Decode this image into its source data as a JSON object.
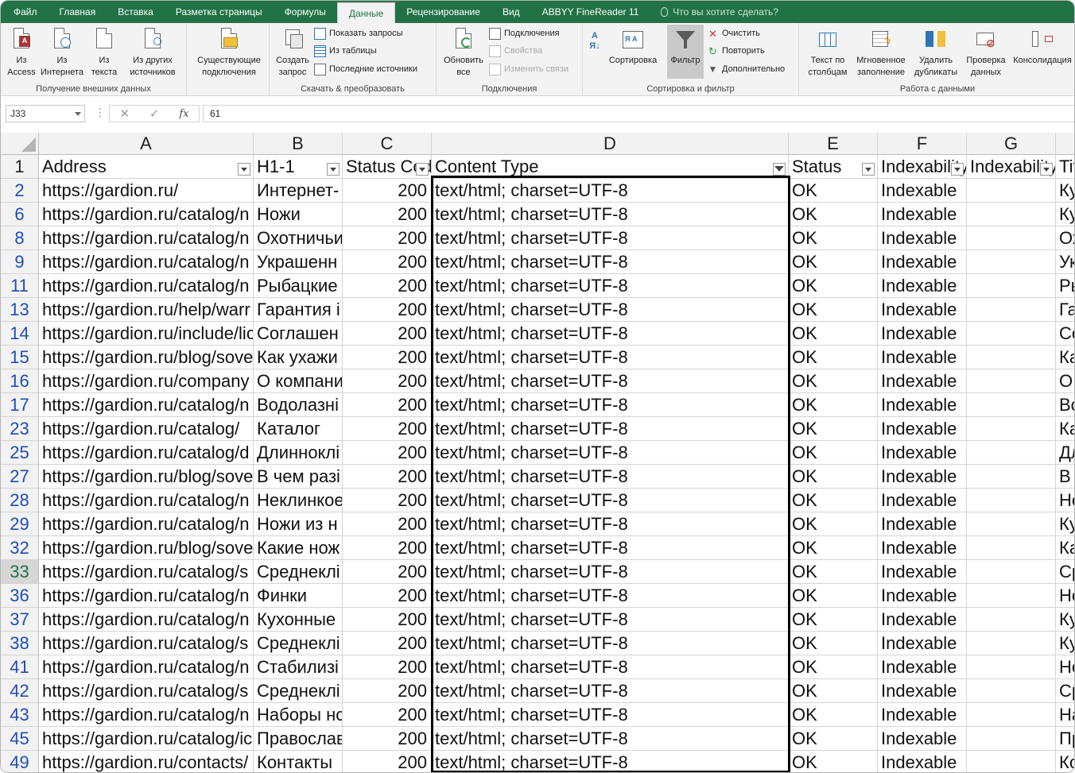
{
  "tabs": [
    "Файл",
    "Главная",
    "Вставка",
    "Разметка страницы",
    "Формулы",
    "Данные",
    "Рецензирование",
    "Вид",
    "ABBYY FineReader 11"
  ],
  "active_tab": "Данные",
  "tell_me": "Что вы хотите сделать?",
  "ribbon": {
    "external": {
      "label": "Получение внешних данных",
      "access": "Из Access",
      "access_l1": "Из",
      "access_l2": "Access",
      "web_l1": "Из",
      "web_l2": "Интернета",
      "text_l1": "Из",
      "text_l2": "текста",
      "other_l1": "Из других",
      "other_l2": "источников",
      "existing_l1": "Существующие",
      "existing_l2": "подключения"
    },
    "transform": {
      "label": "Скачать & преобразовать",
      "new_query_l1": "Создать",
      "new_query_l2": "запрос",
      "show_queries": "Показать запросы",
      "from_table": "Из таблицы",
      "recent_sources": "Последние источники"
    },
    "connections": {
      "label": "Подключения",
      "refresh_l1": "Обновить",
      "refresh_l2": "все",
      "connections": "Подключения",
      "properties": "Свойства",
      "edit_links": "Изменить связи"
    },
    "sortfilter": {
      "label": "Сортировка и фильтр",
      "sort": "Сортировка",
      "filter": "Фильтр",
      "clear": "Очистить",
      "reapply": "Повторить",
      "advanced": "Дополнительно"
    },
    "datatools": {
      "label": "Работа с данными",
      "text_cols_l1": "Текст по",
      "text_cols_l2": "столбцам",
      "flash_l1": "Мгновенное",
      "flash_l2": "заполнение",
      "remove_dup_l1": "Удалить",
      "remove_dup_l2": "дубликаты",
      "validate_l1": "Проверка",
      "validate_l2": "данных",
      "consolidate": "Консолидация"
    }
  },
  "formula_bar": {
    "name_box": "J33",
    "fx": "fx",
    "value": "61"
  },
  "columns": [
    "A",
    "B",
    "C",
    "D",
    "E",
    "F",
    "G",
    ""
  ],
  "header_row": {
    "row": "1",
    "cells": [
      "Address",
      "H1-1",
      "Status Code",
      "Content Type",
      "Status",
      "Indexability",
      "Indexability Status",
      "Title"
    ]
  },
  "selected_row": "33",
  "rows": [
    {
      "n": "2",
      "a": "https://gardion.ru/",
      "b": "Интернет-",
      "c": "200",
      "d": "text/html; charset=UTF-8",
      "e": "OK",
      "f": "Indexable",
      "h": "Ку"
    },
    {
      "n": "6",
      "a": "https://gardion.ru/catalog/n",
      "b": "Ножи",
      "c": "200",
      "d": "text/html; charset=UTF-8",
      "e": "OK",
      "f": "Indexable",
      "h": "Ку"
    },
    {
      "n": "8",
      "a": "https://gardion.ru/catalog/n",
      "b": "Охотничьи",
      "c": "200",
      "d": "text/html; charset=UTF-8",
      "e": "OK",
      "f": "Indexable",
      "h": "Ох"
    },
    {
      "n": "9",
      "a": "https://gardion.ru/catalog/n",
      "b": "Украшенн",
      "c": "200",
      "d": "text/html; charset=UTF-8",
      "e": "OK",
      "f": "Indexable",
      "h": "Ук"
    },
    {
      "n": "11",
      "a": "https://gardion.ru/catalog/n",
      "b": "Рыбацкие",
      "c": "200",
      "d": "text/html; charset=UTF-8",
      "e": "OK",
      "f": "Indexable",
      "h": "Ры"
    },
    {
      "n": "13",
      "a": "https://gardion.ru/help/warr",
      "b": "Гарантия і",
      "c": "200",
      "d": "text/html; charset=UTF-8",
      "e": "OK",
      "f": "Indexable",
      "h": "Га"
    },
    {
      "n": "14",
      "a": "https://gardion.ru/include/lic",
      "b": "Соглашен",
      "c": "200",
      "d": "text/html; charset=UTF-8",
      "e": "OK",
      "f": "Indexable",
      "h": "Со"
    },
    {
      "n": "15",
      "a": "https://gardion.ru/blog/sove",
      "b": "Как ухажи",
      "c": "200",
      "d": "text/html; charset=UTF-8",
      "e": "OK",
      "f": "Indexable",
      "h": "Ка"
    },
    {
      "n": "16",
      "a": "https://gardion.ru/company",
      "b": "О компани",
      "c": "200",
      "d": "text/html; charset=UTF-8",
      "e": "OK",
      "f": "Indexable",
      "h": "О"
    },
    {
      "n": "17",
      "a": "https://gardion.ru/catalog/n",
      "b": "Водолазні",
      "c": "200",
      "d": "text/html; charset=UTF-8",
      "e": "OK",
      "f": "Indexable",
      "h": "Во"
    },
    {
      "n": "23",
      "a": "https://gardion.ru/catalog/",
      "b": "Каталог",
      "c": "200",
      "d": "text/html; charset=UTF-8",
      "e": "OK",
      "f": "Indexable",
      "h": "Ка"
    },
    {
      "n": "25",
      "a": "https://gardion.ru/catalog/d",
      "b": "Длинноклі",
      "c": "200",
      "d": "text/html; charset=UTF-8",
      "e": "OK",
      "f": "Indexable",
      "h": "Дл"
    },
    {
      "n": "27",
      "a": "https://gardion.ru/blog/sove",
      "b": "В чем разі",
      "c": "200",
      "d": "text/html; charset=UTF-8",
      "e": "OK",
      "f": "Indexable",
      "h": "В"
    },
    {
      "n": "28",
      "a": "https://gardion.ru/catalog/n",
      "b": "Неклинкое",
      "c": "200",
      "d": "text/html; charset=UTF-8",
      "e": "OK",
      "f": "Indexable",
      "h": "Не"
    },
    {
      "n": "29",
      "a": "https://gardion.ru/catalog/n",
      "b": "Ножи из н",
      "c": "200",
      "d": "text/html; charset=UTF-8",
      "e": "OK",
      "f": "Indexable",
      "h": "Ку"
    },
    {
      "n": "32",
      "a": "https://gardion.ru/blog/sove",
      "b": "Какие нож",
      "c": "200",
      "d": "text/html; charset=UTF-8",
      "e": "OK",
      "f": "Indexable",
      "h": "Ка"
    },
    {
      "n": "33",
      "a": "https://gardion.ru/catalog/s",
      "b": "Среднеклі",
      "c": "200",
      "d": "text/html; charset=UTF-8",
      "e": "OK",
      "f": "Indexable",
      "h": "Ср"
    },
    {
      "n": "36",
      "a": "https://gardion.ru/catalog/n",
      "b": "Финки",
      "c": "200",
      "d": "text/html; charset=UTF-8",
      "e": "OK",
      "f": "Indexable",
      "h": "Не"
    },
    {
      "n": "37",
      "a": "https://gardion.ru/catalog/n",
      "b": "Кухонные",
      "c": "200",
      "d": "text/html; charset=UTF-8",
      "e": "OK",
      "f": "Indexable",
      "h": "Ку"
    },
    {
      "n": "38",
      "a": "https://gardion.ru/catalog/s",
      "b": "Среднеклі",
      "c": "200",
      "d": "text/html; charset=UTF-8",
      "e": "OK",
      "f": "Indexable",
      "h": "Ку"
    },
    {
      "n": "41",
      "a": "https://gardion.ru/catalog/n",
      "b": "Стабилизі",
      "c": "200",
      "d": "text/html; charset=UTF-8",
      "e": "OK",
      "f": "Indexable",
      "h": "Не"
    },
    {
      "n": "42",
      "a": "https://gardion.ru/catalog/s",
      "b": "Среднеклі",
      "c": "200",
      "d": "text/html; charset=UTF-8",
      "e": "OK",
      "f": "Indexable",
      "h": "Ср"
    },
    {
      "n": "43",
      "a": "https://gardion.ru/catalog/n",
      "b": "Наборы нс",
      "c": "200",
      "d": "text/html; charset=UTF-8",
      "e": "OK",
      "f": "Indexable",
      "h": "На"
    },
    {
      "n": "45",
      "a": "https://gardion.ru/catalog/ic",
      "b": "Православ",
      "c": "200",
      "d": "text/html; charset=UTF-8",
      "e": "OK",
      "f": "Indexable",
      "h": "Пр"
    },
    {
      "n": "49",
      "a": "https://gardion.ru/contacts/",
      "b": "Контакты",
      "c": "200",
      "d": "text/html; charset=UTF-8",
      "e": "OK",
      "f": "Indexable",
      "h": "Ко"
    }
  ],
  "colors": {
    "excel_green": "#217346",
    "ribbon_bg": "#f3f3f3",
    "row_number_blue": "#1f4fb5",
    "selection_border": "#000000"
  }
}
